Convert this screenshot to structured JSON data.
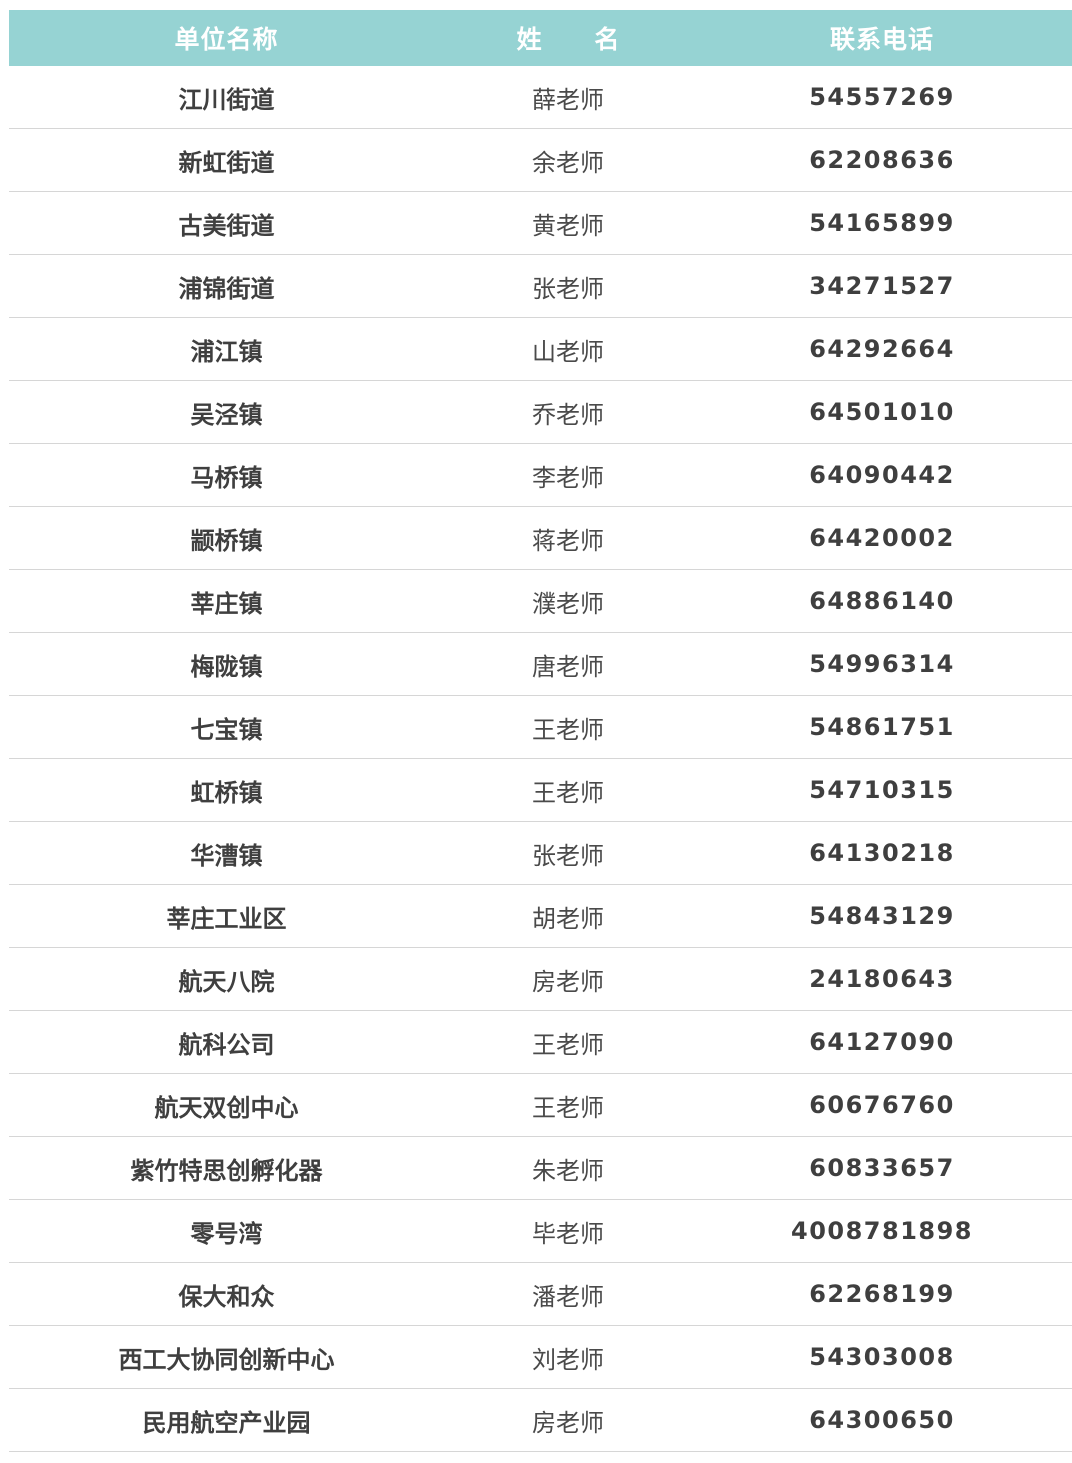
{
  "header": {
    "unit": "单位名称",
    "name": "姓 名",
    "phone": "联系电话"
  },
  "rows": [
    {
      "unit": "江川街道",
      "name": "薛老师",
      "phone": "54557269"
    },
    {
      "unit": "新虹街道",
      "name": "余老师",
      "phone": "62208636"
    },
    {
      "unit": "古美街道",
      "name": "黄老师",
      "phone": "54165899"
    },
    {
      "unit": "浦锦街道",
      "name": "张老师",
      "phone": "34271527"
    },
    {
      "unit": "浦江镇",
      "name": "山老师",
      "phone": "64292664"
    },
    {
      "unit": "吴泾镇",
      "name": "乔老师",
      "phone": "64501010"
    },
    {
      "unit": "马桥镇",
      "name": "李老师",
      "phone": "64090442"
    },
    {
      "unit": "颛桥镇",
      "name": "蒋老师",
      "phone": "64420002"
    },
    {
      "unit": "莘庄镇",
      "name": "濮老师",
      "phone": "64886140"
    },
    {
      "unit": "梅陇镇",
      "name": "唐老师",
      "phone": "54996314"
    },
    {
      "unit": "七宝镇",
      "name": "王老师",
      "phone": "54861751"
    },
    {
      "unit": "虹桥镇",
      "name": "王老师",
      "phone": "54710315"
    },
    {
      "unit": "华漕镇",
      "name": "张老师",
      "phone": "64130218"
    },
    {
      "unit": "莘庄工业区",
      "name": "胡老师",
      "phone": "54843129"
    },
    {
      "unit": "航天八院",
      "name": "房老师",
      "phone": "24180643"
    },
    {
      "unit": "航科公司",
      "name": "王老师",
      "phone": "64127090"
    },
    {
      "unit": "航天双创中心",
      "name": "王老师",
      "phone": "60676760"
    },
    {
      "unit": "紫竹特思创孵化器",
      "name": "朱老师",
      "phone": "60833657"
    },
    {
      "unit": "零号湾",
      "name": "毕老师",
      "phone": "4008781898"
    },
    {
      "unit": "保大和众",
      "name": "潘老师",
      "phone": "62268199"
    },
    {
      "unit": "西工大协同创新中心",
      "name": "刘老师",
      "phone": "54303008"
    },
    {
      "unit": "民用航空产业园",
      "name": "房老师",
      "phone": "64300650"
    }
  ],
  "colors": {
    "header_bg": "#96d3d3",
    "header_text": "#ffffff",
    "body_text": "#3f3f3f",
    "divider": "#d6d6d6"
  }
}
